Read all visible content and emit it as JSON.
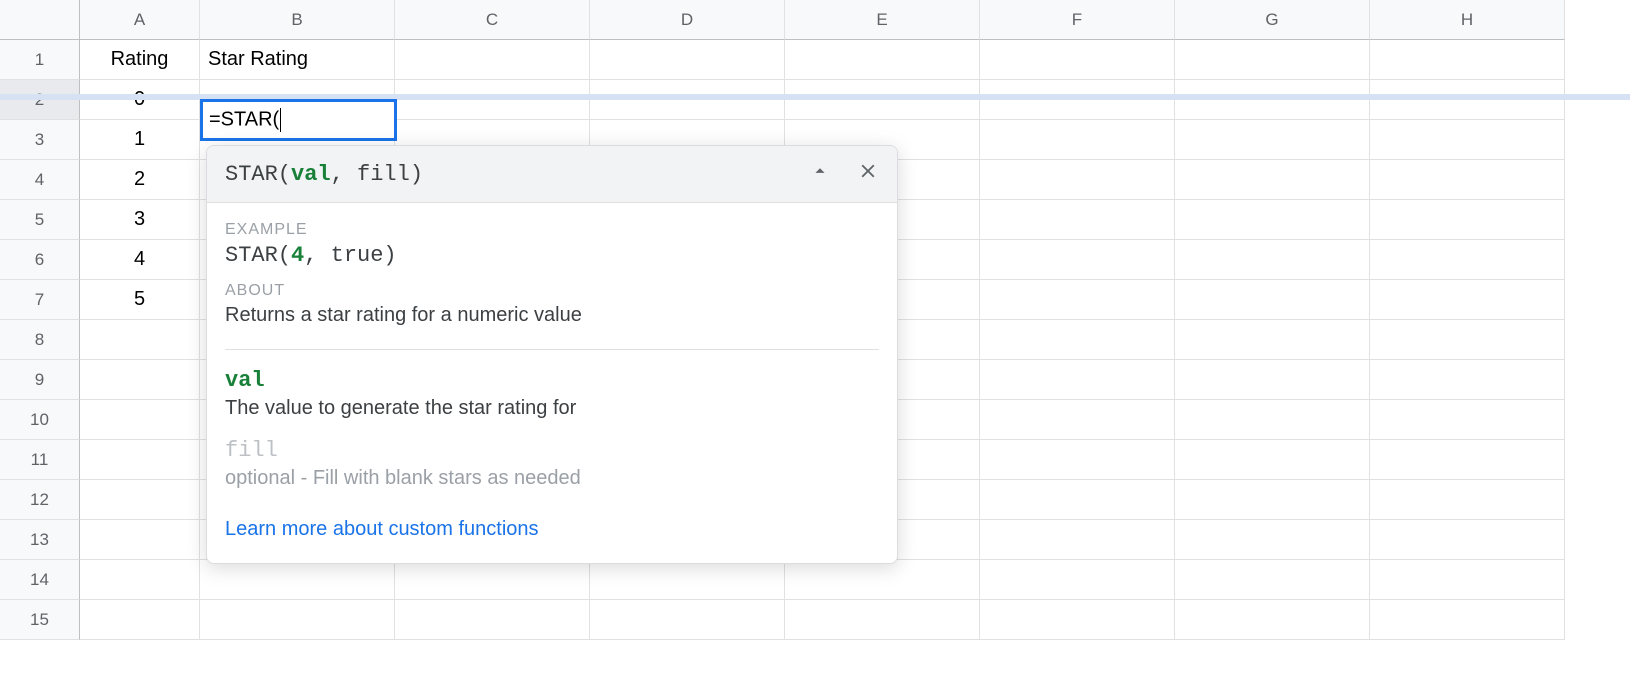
{
  "columns": [
    "A",
    "B",
    "C",
    "D",
    "E",
    "F",
    "G",
    "H"
  ],
  "row_numbers": [
    "1",
    "2",
    "3",
    "4",
    "5",
    "6",
    "7",
    "8",
    "9",
    "10",
    "11",
    "12",
    "13",
    "14",
    "15"
  ],
  "headers": {
    "A": "Rating",
    "B": "Star Rating"
  },
  "colA_values": {
    "r2": "0",
    "r3": "1",
    "r4": "2",
    "r5": "3",
    "r6": "4",
    "r7": "5"
  },
  "active_cell": {
    "formula": "=STAR("
  },
  "tooltip": {
    "signature": {
      "func": "STAR(",
      "arg_active": "val",
      "sep": ", ",
      "arg_other": "fill",
      "close": ")"
    },
    "example_label": "EXAMPLE",
    "example": {
      "pre": "STAR(",
      "num": "4",
      "post": ", true)"
    },
    "about_label": "ABOUT",
    "about_text": "Returns a star rating for a numeric value",
    "arg1": {
      "name": "val",
      "desc": "The value to generate the star rating for"
    },
    "arg2": {
      "name": "fill",
      "desc": "optional - Fill with blank stars as needed"
    },
    "link_text": "Learn more about custom functions"
  }
}
